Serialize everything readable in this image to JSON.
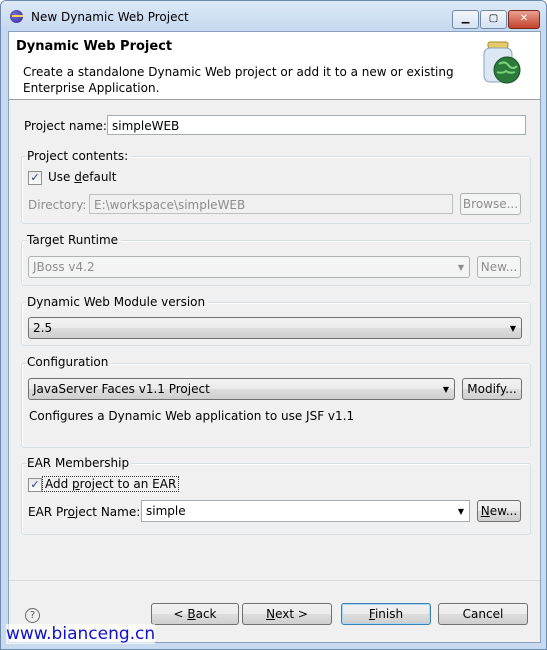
{
  "window": {
    "title": "New Dynamic Web Project",
    "controls": {
      "minimize": "▁",
      "maximize": "▢",
      "close": "✕"
    }
  },
  "banner": {
    "title": "Dynamic Web Project",
    "description": "Create a standalone Dynamic Web project or add it to a new or existing Enterprise Application.",
    "icon": "web-project-jar-globe-icon"
  },
  "project_name": {
    "label": "Project name:",
    "value": "simpleWEB"
  },
  "project_contents": {
    "group_label": "Project contents:",
    "use_default": {
      "pre": "Use ",
      "mnemonic": "d",
      "post": "efault",
      "checked": true
    },
    "directory_label": "Directory:",
    "directory_value": "E:\\workspace\\simpleWEB",
    "browse_label": "Browse..."
  },
  "target_runtime": {
    "group_label": "Target Runtime",
    "selected": "JBoss v4.2",
    "new_label": "New..."
  },
  "module_version": {
    "group_label": "Dynamic Web Module version",
    "selected": "2.5"
  },
  "configuration": {
    "group_label": "Configuration",
    "selected": "JavaServer Faces v1.1 Project",
    "modify_label": "Modify...",
    "description": "Configures a Dynamic Web application to use JSF v1.1"
  },
  "ear": {
    "group_label": "EAR Membership",
    "add_to_ear": {
      "pre": "Add ",
      "mnemonic": "p",
      "post": "roject to an EAR",
      "checked": true
    },
    "project_name_label_pre": "EAR Pr",
    "project_name_label_mn": "o",
    "project_name_label_post": "ject Name:",
    "project_name_value": "simple",
    "new_pre": "",
    "new_mn": "N",
    "new_post": "ew..."
  },
  "footer": {
    "help": "?",
    "back": {
      "pre": "< ",
      "mn": "B",
      "post": "ack"
    },
    "next": {
      "mn": "N",
      "post": "ext >"
    },
    "finish": {
      "mn": "F",
      "post": "inish"
    },
    "cancel": "Cancel"
  },
  "watermark": "www.bianceng.cn",
  "colors": {
    "accent": "#3c7fb1",
    "title_bar": "#c4d8ef",
    "watermark": "#1111cc"
  }
}
